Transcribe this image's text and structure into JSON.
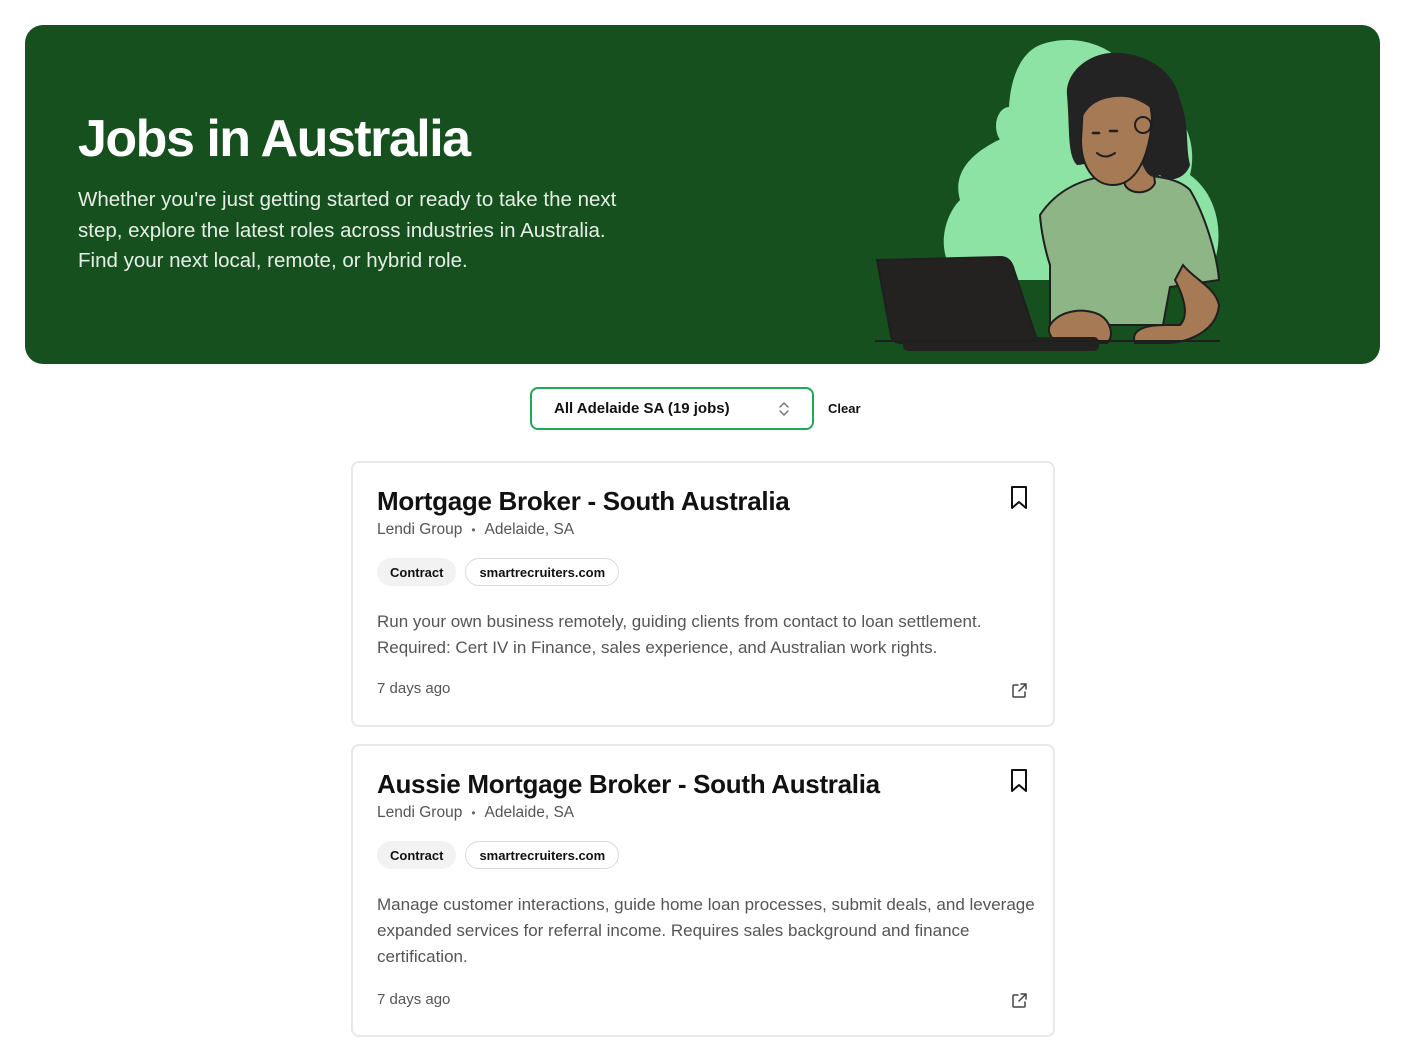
{
  "hero": {
    "title": "Jobs in Australia",
    "subtitle_line1": "Whether you're just getting started or ready to take the next",
    "subtitle_line2": "step, explore the latest roles across industries in Australia.",
    "subtitle_line3": "Find your next local, remote, or hybrid role.",
    "background_color": "#17501f",
    "illustration": "person-with-laptop-illustration"
  },
  "filter": {
    "location_select_value": "All Adelaide SA (19 jobs)",
    "clear_label": "Clear",
    "accent_color": "#1faa54"
  },
  "jobs": [
    {
      "title": "Mortgage Broker - South Australia",
      "company": "Lendi Group",
      "location": "Adelaide, SA",
      "type": "Contract",
      "source": "smartrecruiters.com",
      "description": "Run your own business remotely, guiding clients from contact to loan settlement. Required: Cert IV in Finance, sales experience, and Australian work rights.",
      "posted": "7 days ago"
    },
    {
      "title": "Aussie Mortgage Broker - South Australia",
      "company": "Lendi Group",
      "location": "Adelaide, SA",
      "type": "Contract",
      "source": "smartrecruiters.com",
      "description": "Manage customer interactions, guide home loan processes, submit deals, and leverage expanded services for referral income. Requires sales background and finance certification.",
      "posted": "7 days ago"
    }
  ],
  "icons": {
    "bookmark": "bookmark-icon",
    "external_link": "external-link-icon",
    "select_chevron": "chevron-up-down-icon"
  }
}
